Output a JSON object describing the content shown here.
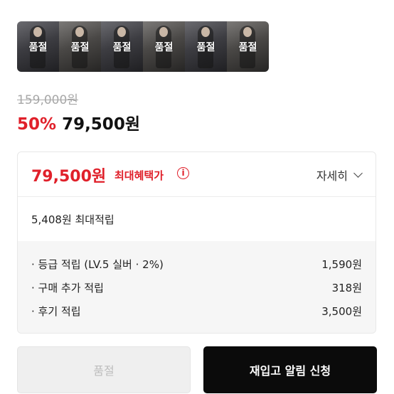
{
  "thumbnails": [
    {
      "status": "품절"
    },
    {
      "status": "품절"
    },
    {
      "status": "품절"
    },
    {
      "status": "품절"
    },
    {
      "status": "품절"
    },
    {
      "status": "품절"
    }
  ],
  "pricing": {
    "original_price": "159,000원",
    "discount_rate": "50%",
    "sale_price": "79,500원"
  },
  "benefit": {
    "price": "79,500원",
    "label": "최대혜택가",
    "info_glyph": "i",
    "detail_label": "자세히"
  },
  "points": {
    "total": "5,408원 최대적립",
    "items": [
      {
        "label": "· 등급 적립 (LV.5 실버 · 2%)",
        "value": "1,590원"
      },
      {
        "label": "· 구매 추가 적립",
        "value": "318원"
      },
      {
        "label": "· 후기 적립",
        "value": "3,500원"
      }
    ]
  },
  "actions": {
    "soldout_label": "품절",
    "restock_label": "재입고 알림 신청"
  },
  "colors": {
    "accent": "#e0202a",
    "button_dark": "#0b0b0b",
    "star": "#f5b300"
  },
  "icons": {
    "star": "star-icon",
    "info": "info-icon",
    "chevron": "chevron-down-icon"
  }
}
